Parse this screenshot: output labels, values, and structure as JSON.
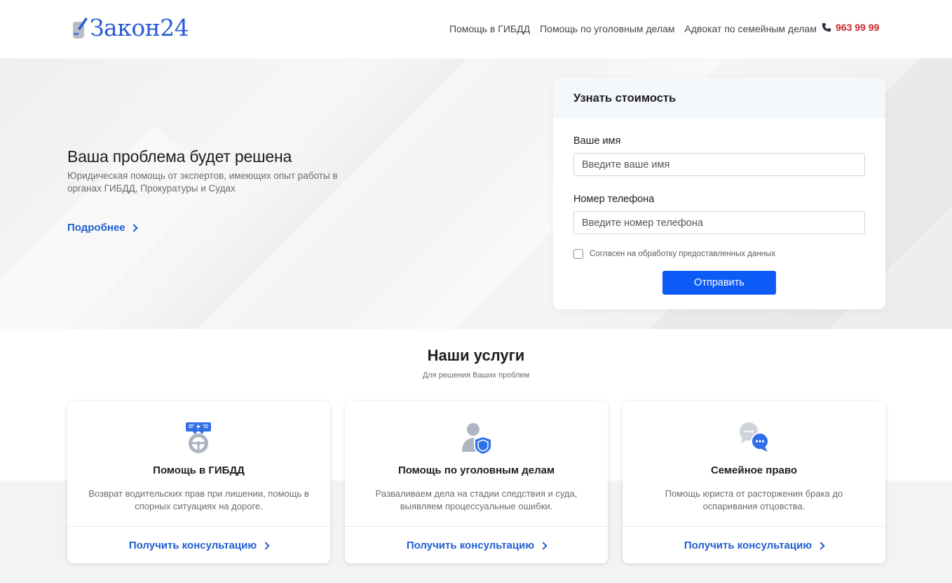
{
  "header": {
    "logo_text": "Закон24",
    "nav": [
      {
        "label": "Помощь в ГИБДД"
      },
      {
        "label": "Помощь по уголовным делам"
      },
      {
        "label": "Адвокат по семейным делам"
      }
    ],
    "phone": "963 99 99"
  },
  "hero": {
    "title": "Ваша проблема будет решена",
    "subtitle": "Юридическая помощь от экспертов, имеющих опыт работы в органах ГИБДД, Прокуратуры и Судах",
    "more_link": "Подробнее"
  },
  "form": {
    "title": "Узнать стоимость",
    "name_label": "Ваше имя",
    "name_placeholder": "Введите ваше имя",
    "phone_label": "Номер телефона",
    "phone_placeholder": "Введите номер телефона",
    "consent_label": "Согласен на обработку предоставленных данных",
    "consent_checked": false,
    "submit_label": "Отправить"
  },
  "services": {
    "title": "Наши услуги",
    "subtitle": "Для решения Ваших проблем",
    "cards": [
      {
        "title": "Помощь в ГИБДД",
        "desc": "Возврат водительских прав при лишении, помощь в спорных ситуациях на дороге.",
        "link": "Получить консультацию",
        "icon": "steering-wheel-icon"
      },
      {
        "title": "Помощь по уголовным делам",
        "desc": "Разваливаем дела на стадии следствия и суда, выявляем процессуальные ошибки.",
        "link": "Получить консультацию",
        "icon": "person-shield-icon"
      },
      {
        "title": "Семейное право",
        "desc": "Помощь юриста от расторжения брака до оспаривания отцовства.",
        "link": "Получить консультацию",
        "icon": "chat-bubbles-icon"
      }
    ]
  },
  "colors": {
    "accent": "#0d5bf6",
    "link": "#1f5fd1",
    "phone": "#d0242a",
    "logo": "#2a5bd7"
  }
}
